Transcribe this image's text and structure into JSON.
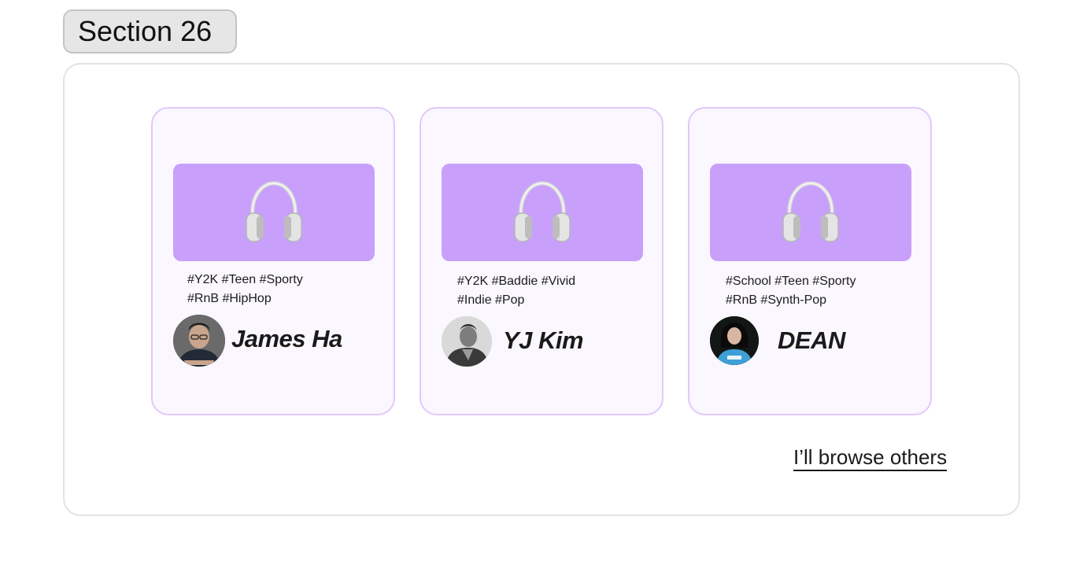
{
  "section": {
    "title": "Section 26"
  },
  "cards": [
    {
      "tags_line1": "#Y2K #Teen #Sporty",
      "tags_line2": "#RnB #HipHop",
      "name": "James Ha"
    },
    {
      "tags_line1": "#Y2K #Baddie #Vivid",
      "tags_line2": "#Indie #Pop",
      "name": "YJ Kim"
    },
    {
      "tags_line1": "#School #Teen #Sporty",
      "tags_line2": "#RnB #Synth-Pop",
      "name": "DEAN"
    }
  ],
  "browse_link": "I’ll browse others",
  "icons": {
    "banner": "headphones-icon"
  },
  "colors": {
    "banner": "#c8a0fb",
    "card_border": "#e2c8fb",
    "card_background": "#faf7fe"
  }
}
